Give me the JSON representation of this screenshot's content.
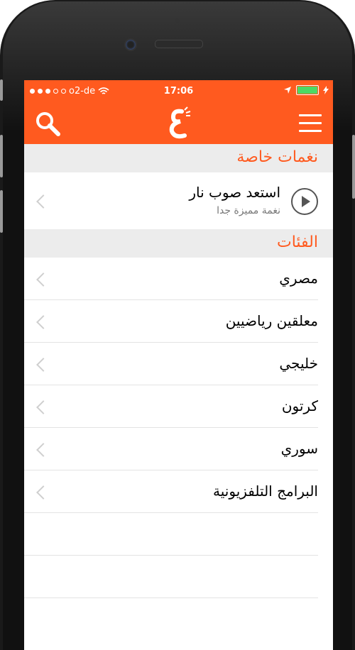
{
  "status": {
    "carrier": "o2-de",
    "time": "17:06"
  },
  "header": {
    "search_icon": "search-icon",
    "logo_icon": "logo-icon",
    "menu_icon": "menu-icon"
  },
  "featured": {
    "title": "نغمات خاصة",
    "item": {
      "title": "استعد صوب نار",
      "subtitle": "نغمة مميزة جدا"
    }
  },
  "categories": {
    "title": "الفئات",
    "items": [
      "مصري",
      "معلقين رياضيين",
      "خليجي",
      "كرتون",
      "سوري",
      "البرامج التلفزيونية"
    ]
  },
  "colors": {
    "accent": "#ff5a1f",
    "section_bg": "#ececec",
    "battery": "#4cd964"
  }
}
